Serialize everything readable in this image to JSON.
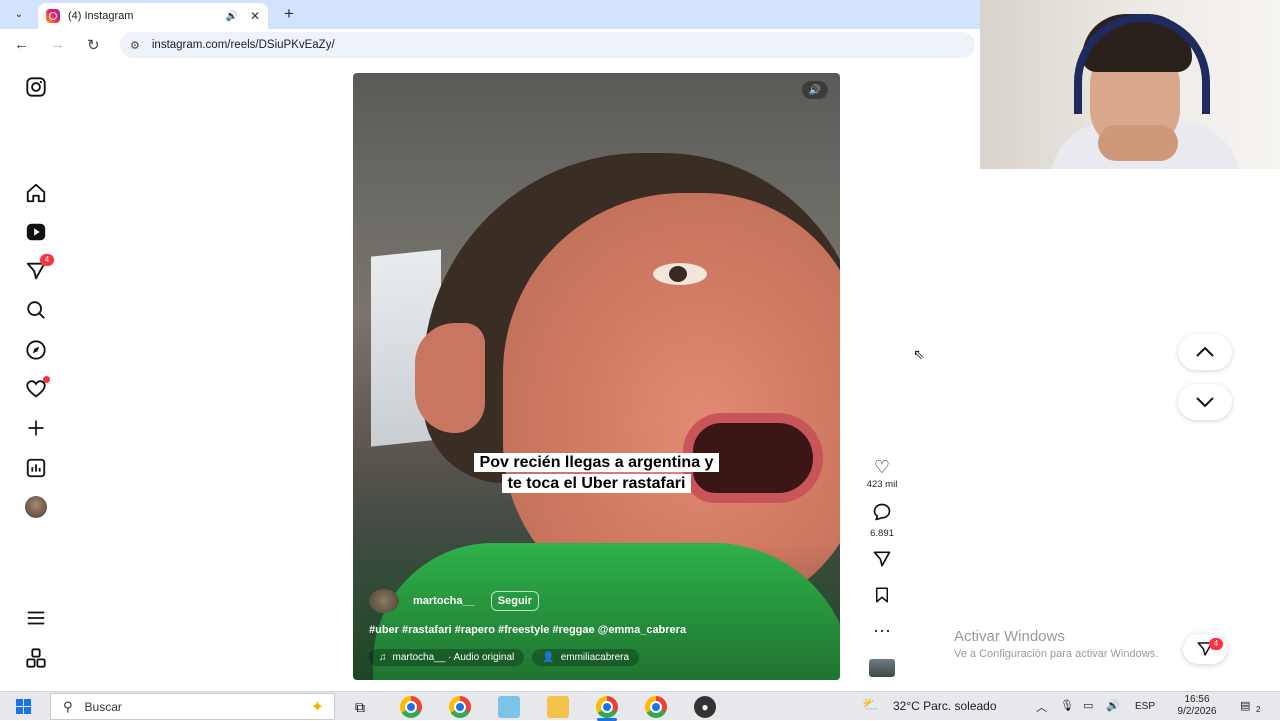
{
  "browser": {
    "tab_title": "(4) Instagram",
    "url": "instagram.com/reels/DSiuPKvEaZy/"
  },
  "instagram": {
    "nav": {
      "messages_badge": "4"
    },
    "reel": {
      "caption_line1": "Pov recién llegas a argentina y",
      "caption_line2": "te toca el Uber rastafari",
      "username": "martocha__",
      "follow_label": "Seguir",
      "hashtags": "#uber #rastafari #rapero #freestyle #reggae @emma_cabrera",
      "audio_label": "martocha__ · Audio original",
      "tagged_user": "emmiliacabrera"
    },
    "actions": {
      "likes_count": "423 mil",
      "comments_count": "6.891"
    },
    "messages_fab_badge": "4"
  },
  "watermark": {
    "title": "Activar Windows",
    "subtitle": "Ve a Configuración para activar Windows."
  },
  "taskbar": {
    "search_placeholder": "Buscar",
    "weather": "32°C  Parc. soleado",
    "language": "ESP",
    "time": "16:56",
    "date": "9/2/2026",
    "notification_count": "2"
  }
}
